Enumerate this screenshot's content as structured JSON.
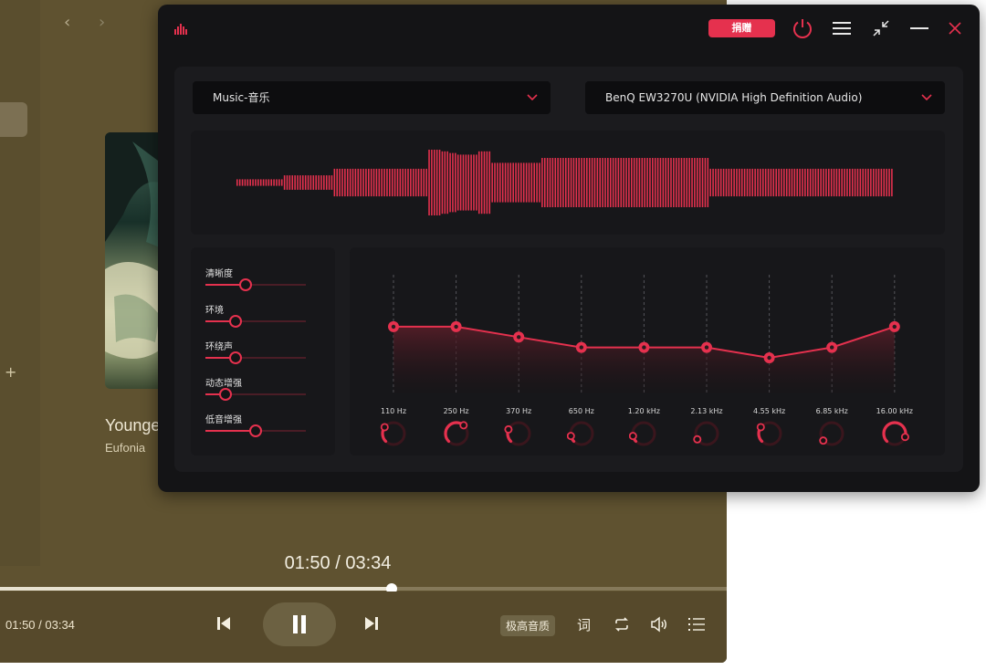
{
  "player": {
    "nav_back": "‹",
    "nav_forward": "›",
    "add_icon": "+",
    "song_title": "Younge",
    "song_artist": "Eufonia",
    "big_time": "01:50 / 03:34",
    "small_time": "01:50 / 03:34",
    "progress_fraction": 0.539,
    "quality_label": "极高音质",
    "lyrics_label": "词",
    "icons": [
      "back-arrow-icon",
      "forward-arrow-icon",
      "add-icon",
      "previous-icon",
      "pause-icon",
      "next-icon",
      "repeat-icon",
      "volume-icon",
      "playlist-icon"
    ]
  },
  "eq": {
    "donate_label": "捐赠",
    "output_mode": "Music-音乐",
    "output_device": "BenQ EW3270U (NVIDIA High Definition Audio)",
    "accent_color": "#e5314e",
    "effects": [
      {
        "label": "清晰度",
        "level": 0.4
      },
      {
        "label": "环境",
        "level": 0.3
      },
      {
        "label": "环绕声",
        "level": 0.3
      },
      {
        "label": "动态增强",
        "level": 0.2
      },
      {
        "label": "低音增强",
        "level": 0.5
      }
    ],
    "bands": [
      {
        "label": "110 Hz",
        "gain": 0.45,
        "knob": 0.3
      },
      {
        "label": "250 Hz",
        "gain": 0.45,
        "knob": 0.65
      },
      {
        "label": "370 Hz",
        "gain": 0.38,
        "knob": 0.25
      },
      {
        "label": "650 Hz",
        "gain": 0.31,
        "knob": 0.12
      },
      {
        "label": "1.20 kHz",
        "gain": 0.31,
        "knob": 0.12
      },
      {
        "label": "2.13 kHz",
        "gain": 0.31,
        "knob": 0.05
      },
      {
        "label": "4.55 kHz",
        "gain": 0.24,
        "knob": 0.3
      },
      {
        "label": "6.85 kHz",
        "gain": 0.31,
        "knob": 0.02
      },
      {
        "label": "16.00 kHz",
        "gain": 0.45,
        "knob": 0.9
      }
    ],
    "waveform": [
      0.1,
      0.1,
      0.1,
      0.1,
      0.1,
      0.1,
      0.1,
      0.1,
      0.1,
      0.1,
      0.1,
      0.1,
      0.1,
      0.1,
      0.1,
      0.1,
      0.1,
      0.1,
      0.22,
      0.22,
      0.22,
      0.22,
      0.22,
      0.22,
      0.22,
      0.22,
      0.22,
      0.22,
      0.22,
      0.22,
      0.22,
      0.22,
      0.22,
      0.22,
      0.22,
      0.22,
      0.22,
      0.42,
      0.42,
      0.42,
      0.42,
      0.42,
      0.42,
      0.42,
      0.42,
      0.42,
      0.42,
      0.42,
      0.42,
      0.42,
      0.42,
      0.42,
      0.42,
      0.42,
      0.42,
      0.42,
      0.42,
      0.42,
      0.42,
      0.42,
      0.42,
      0.42,
      0.42,
      0.42,
      0.42,
      0.42,
      0.42,
      0.42,
      0.42,
      0.42,
      0.42,
      0.42,
      0.42,
      1.0,
      1.0,
      1.0,
      1.0,
      1.0,
      0.95,
      0.95,
      0.95,
      0.9,
      0.9,
      0.9,
      0.85,
      0.85,
      0.85,
      0.85,
      0.85,
      0.85,
      0.85,
      0.85,
      0.95,
      0.95,
      0.95,
      0.95,
      0.95,
      0.6,
      0.6,
      0.6,
      0.6,
      0.6,
      0.6,
      0.6,
      0.6,
      0.6,
      0.6,
      0.6,
      0.6,
      0.6,
      0.6,
      0.6,
      0.6,
      0.6,
      0.6,
      0.6,
      0.75,
      0.75,
      0.75,
      0.75,
      0.75,
      0.75,
      0.75,
      0.75,
      0.75,
      0.75,
      0.75,
      0.75,
      0.75,
      0.75,
      0.75,
      0.75,
      0.75,
      0.75,
      0.75,
      0.75,
      0.75,
      0.75,
      0.75,
      0.75,
      0.75,
      0.75,
      0.75,
      0.75,
      0.75,
      0.75,
      0.75,
      0.75,
      0.75,
      0.75,
      0.75,
      0.75,
      0.75,
      0.75,
      0.75,
      0.75,
      0.75,
      0.75,
      0.75,
      0.75,
      0.75,
      0.75,
      0.75,
      0.75,
      0.75,
      0.75,
      0.75,
      0.75,
      0.75,
      0.75,
      0.75,
      0.75,
      0.75,
      0.75,
      0.75,
      0.75,
      0.75,
      0.75,
      0.75,
      0.75,
      0.42,
      0.42,
      0.42,
      0.42,
      0.42,
      0.42,
      0.42,
      0.42,
      0.42,
      0.42,
      0.42,
      0.42,
      0.42,
      0.42,
      0.42,
      0.42,
      0.42,
      0.42,
      0.42,
      0.42,
      0.42,
      0.42,
      0.42,
      0.42,
      0.42,
      0.42,
      0.42,
      0.42,
      0.42,
      0.42,
      0.42,
      0.42,
      0.42,
      0.42,
      0.42,
      0.42,
      0.42,
      0.42,
      0.42,
      0.42,
      0.42,
      0.42,
      0.42,
      0.42,
      0.42,
      0.42,
      0.42,
      0.42,
      0.42,
      0.42,
      0.42,
      0.42,
      0.42,
      0.42,
      0.42,
      0.42,
      0.42,
      0.42,
      0.42,
      0.42,
      0.42,
      0.42,
      0.42,
      0.42,
      0.42,
      0.42,
      0.42,
      0.42,
      0.42,
      0.42
    ]
  }
}
